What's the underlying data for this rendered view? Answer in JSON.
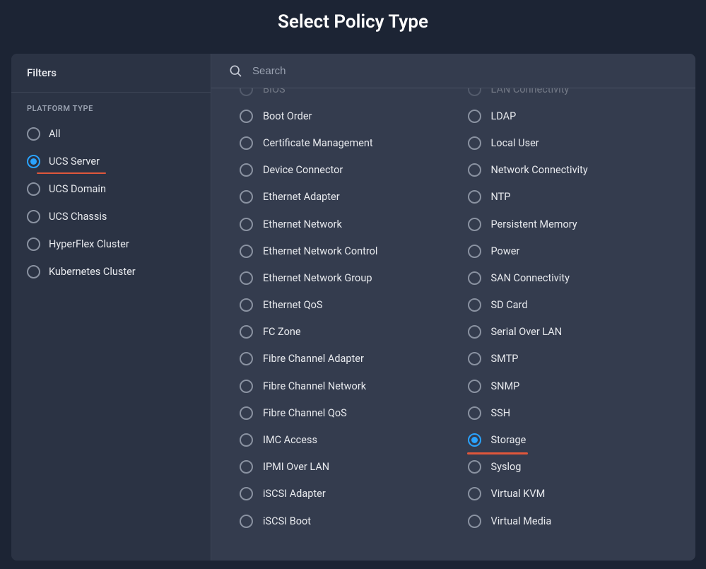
{
  "header": {
    "title": "Select Policy Type"
  },
  "sidebar": {
    "title": "Filters",
    "section_label": "PLATFORM TYPE",
    "items": [
      {
        "label": "All",
        "selected": false
      },
      {
        "label": "UCS Server",
        "selected": true,
        "underlined": true,
        "underline_width": 98
      },
      {
        "label": "UCS Domain",
        "selected": false
      },
      {
        "label": "UCS Chassis",
        "selected": false
      },
      {
        "label": "HyperFlex Cluster",
        "selected": false
      },
      {
        "label": "Kubernetes Cluster",
        "selected": false
      }
    ]
  },
  "search": {
    "placeholder": "Search",
    "value": "",
    "icon_name": "search-icon"
  },
  "policies": {
    "columns": [
      [
        {
          "label": "BIOS",
          "selected": false,
          "cutoff": true
        },
        {
          "label": "Boot Order",
          "selected": false
        },
        {
          "label": "Certificate Management",
          "selected": false
        },
        {
          "label": "Device Connector",
          "selected": false
        },
        {
          "label": "Ethernet Adapter",
          "selected": false
        },
        {
          "label": "Ethernet Network",
          "selected": false
        },
        {
          "label": "Ethernet Network Control",
          "selected": false
        },
        {
          "label": "Ethernet Network Group",
          "selected": false
        },
        {
          "label": "Ethernet QoS",
          "selected": false
        },
        {
          "label": "FC Zone",
          "selected": false
        },
        {
          "label": "Fibre Channel Adapter",
          "selected": false
        },
        {
          "label": "Fibre Channel Network",
          "selected": false
        },
        {
          "label": "Fibre Channel QoS",
          "selected": false
        },
        {
          "label": "IMC Access",
          "selected": false
        },
        {
          "label": "IPMI Over LAN",
          "selected": false
        },
        {
          "label": "iSCSI Adapter",
          "selected": false
        },
        {
          "label": "iSCSI Boot",
          "selected": false
        }
      ],
      [
        {
          "label": "LAN Connectivity",
          "selected": false,
          "cutoff": true
        },
        {
          "label": "LDAP",
          "selected": false
        },
        {
          "label": "Local User",
          "selected": false
        },
        {
          "label": "Network Connectivity",
          "selected": false
        },
        {
          "label": "NTP",
          "selected": false
        },
        {
          "label": "Persistent Memory",
          "selected": false
        },
        {
          "label": "Power",
          "selected": false
        },
        {
          "label": "SAN Connectivity",
          "selected": false
        },
        {
          "label": "SD Card",
          "selected": false
        },
        {
          "label": "Serial Over LAN",
          "selected": false
        },
        {
          "label": "SMTP",
          "selected": false
        },
        {
          "label": "SNMP",
          "selected": false
        },
        {
          "label": "SSH",
          "selected": false
        },
        {
          "label": "Storage",
          "selected": true,
          "underlined": true,
          "underline_width": 86
        },
        {
          "label": "Syslog",
          "selected": false
        },
        {
          "label": "Virtual KVM",
          "selected": false
        },
        {
          "label": "Virtual Media",
          "selected": false
        }
      ]
    ]
  },
  "colors": {
    "background": "#1c2434",
    "panel": "#343c4e",
    "sidebar": "#2b3344",
    "accent": "#2aa3ff",
    "highlight": "#e0573b"
  }
}
